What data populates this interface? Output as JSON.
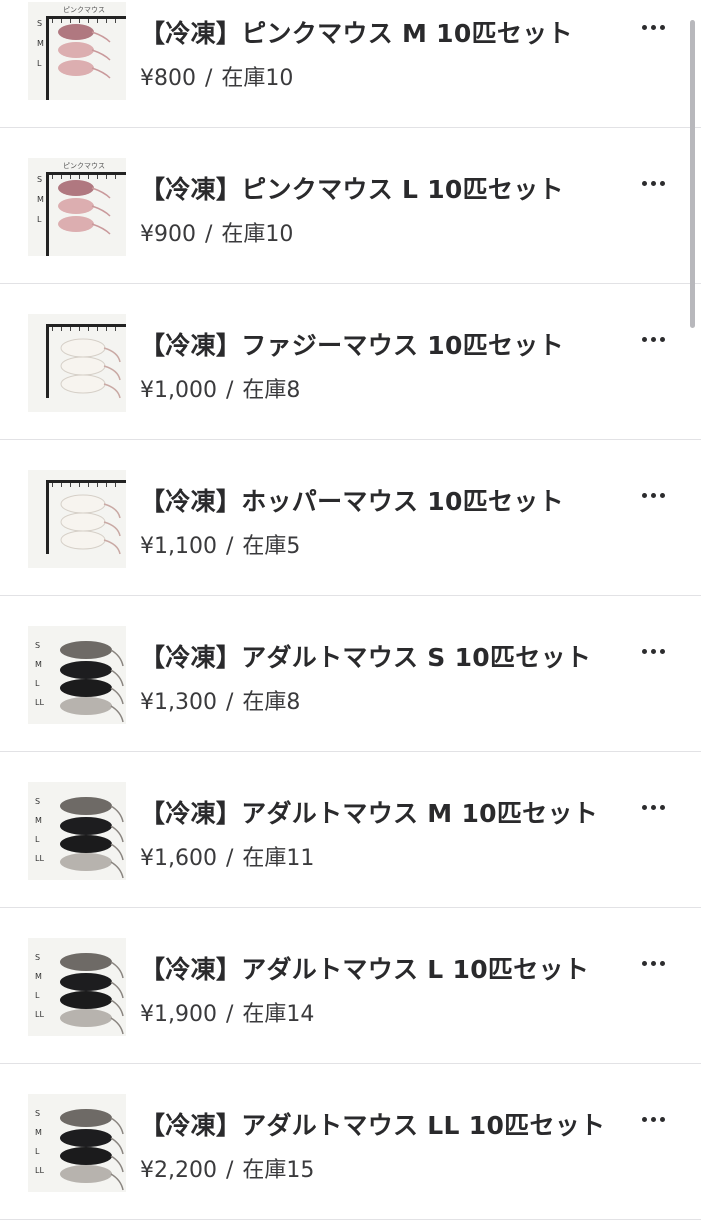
{
  "products": [
    {
      "title": "【冷凍】ピンクマウス M 10匹セット",
      "price": "¥800",
      "stock": "在庫10",
      "thumb": {
        "kind": "pink",
        "caption": "ピンクマウス",
        "labels": [
          "S",
          "M",
          "L"
        ]
      }
    },
    {
      "title": "【冷凍】ピンクマウス L 10匹セット",
      "price": "¥900",
      "stock": "在庫10",
      "thumb": {
        "kind": "pink",
        "caption": "ピンクマウス",
        "labels": [
          "S",
          "M",
          "L"
        ]
      }
    },
    {
      "title": "【冷凍】ファジーマウス 10匹セット",
      "price": "¥1,000",
      "stock": "在庫8",
      "thumb": {
        "kind": "fuzzy",
        "caption": "",
        "labels": []
      }
    },
    {
      "title": "【冷凍】ホッパーマウス 10匹セット",
      "price": "¥1,100",
      "stock": "在庫5",
      "thumb": {
        "kind": "fuzzy",
        "caption": "",
        "labels": []
      }
    },
    {
      "title": "【冷凍】アダルトマウス S 10匹セット",
      "price": "¥1,300",
      "stock": "在庫8",
      "thumb": {
        "kind": "adult",
        "caption": "",
        "labels": [
          "S",
          "M",
          "L",
          "LL"
        ]
      }
    },
    {
      "title": "【冷凍】アダルトマウス M 10匹セット",
      "price": "¥1,600",
      "stock": "在庫11",
      "thumb": {
        "kind": "adult",
        "caption": "",
        "labels": [
          "S",
          "M",
          "L",
          "LL"
        ]
      }
    },
    {
      "title": "【冷凍】アダルトマウス L 10匹セット",
      "price": "¥1,900",
      "stock": "在庫14",
      "thumb": {
        "kind": "adult",
        "caption": "",
        "labels": [
          "S",
          "M",
          "L",
          "LL"
        ]
      }
    },
    {
      "title": "【冷凍】アダルトマウス LL 10匹セット",
      "price": "¥2,200",
      "stock": "在庫15",
      "thumb": {
        "kind": "adult",
        "caption": "",
        "labels": [
          "S",
          "M",
          "L",
          "LL"
        ]
      }
    }
  ],
  "separator": "/",
  "more_icon": "more-horizontal-icon",
  "colors": {
    "text": "#2a2a2c",
    "divider": "#e2e2e5",
    "scrollbar": "#b8b8bc"
  }
}
